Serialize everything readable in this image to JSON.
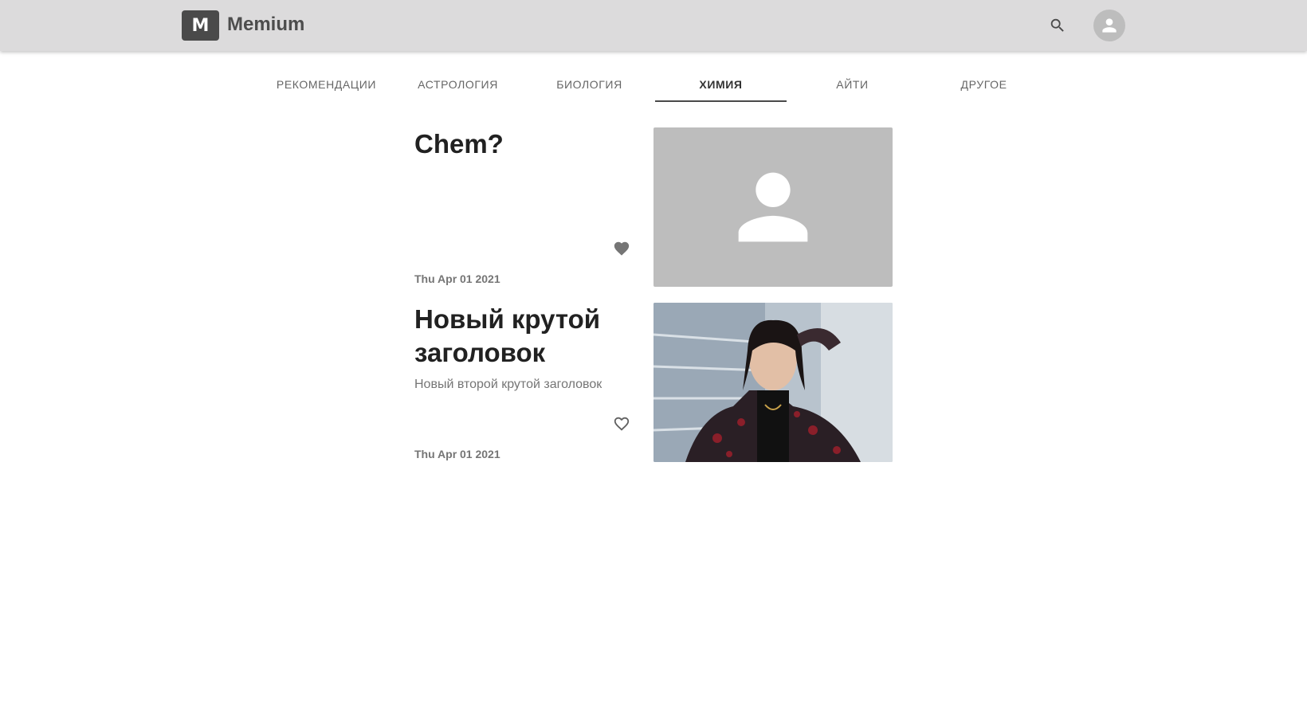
{
  "appbar": {
    "logo_letter": "M",
    "brand_name": "Memium"
  },
  "tabs": [
    {
      "label": "Рекомендации",
      "active": false
    },
    {
      "label": "Астрология",
      "active": false
    },
    {
      "label": "Биология",
      "active": false
    },
    {
      "label": "Химия",
      "active": true
    },
    {
      "label": "Айти",
      "active": false
    },
    {
      "label": "Другое",
      "active": false
    }
  ],
  "posts": [
    {
      "title": "Chem?",
      "subtitle": "",
      "date": "Thu Apr 01 2021",
      "liked": true,
      "image": "person-placeholder-icon"
    },
    {
      "title": "Новый крутой заголовок",
      "subtitle": "Новый второй крутой заголовок",
      "date": "Thu Apr 01 2021",
      "liked": false,
      "image": "photo"
    }
  ],
  "colors": {
    "appbar_bg": "#dcdbdc",
    "logo_bg": "#4a4a4a",
    "placeholder_bg": "#bdbdbd",
    "active_tab_indicator": "#4a4a4a"
  }
}
